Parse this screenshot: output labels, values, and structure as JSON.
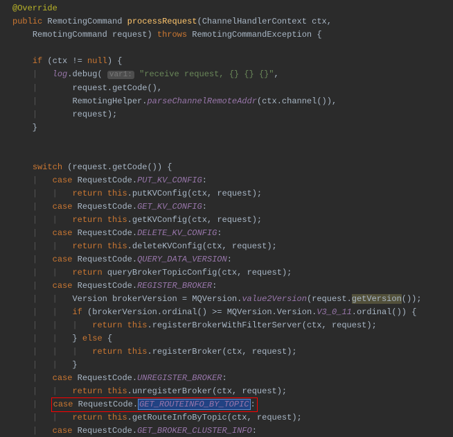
{
  "code": {
    "override": "@Override",
    "public": "public",
    "throws": "throws",
    "if": "if",
    "switch": "switch",
    "case": "case",
    "return": "return",
    "this": "this",
    "else": "else",
    "null": "null",
    "RemotingCommand": "RemotingCommand",
    "processRequest": "processRequest",
    "ChannelHandlerContext": "ChannelHandlerContext",
    "ctx": "ctx",
    "request": "request",
    "RemotingCommandException": "RemotingCommandException",
    "log": "log",
    "debug": "debug",
    "hint_var1": "var1:",
    "str_receive": "\"receive request, {} {} {}\"",
    "getCode": "getCode",
    "RemotingHelper": "RemotingHelper",
    "parseChannelRemoteAddr": "parseChannelRemoteAddr",
    "channel": "channel",
    "RequestCode": "RequestCode",
    "PUT_KV_CONFIG": "PUT_KV_CONFIG",
    "putKVConfig": "putKVConfig",
    "GET_KV_CONFIG": "GET_KV_CONFIG",
    "getKVConfig": "getKVConfig",
    "DELETE_KV_CONFIG": "DELETE_KV_CONFIG",
    "deleteKVConfig": "deleteKVConfig",
    "QUERY_DATA_VERSION": "QUERY_DATA_VERSION",
    "queryBrokerTopicConfig": "queryBrokerTopicConfig",
    "REGISTER_BROKER": "REGISTER_BROKER",
    "Version": "Version",
    "brokerVersion": "brokerVersion",
    "MQVersion": "MQVersion",
    "value2Version": "value2Version",
    "getVersion": "getVersion",
    "ordinal": "ordinal",
    "V3_0_11": "V3_0_11",
    "registerBrokerWithFilterServer": "registerBrokerWithFilterServer",
    "registerBroker": "registerBroker",
    "UNREGISTER_BROKER": "UNREGISTER_BROKER",
    "unregisterBroker": "unregisterBroker",
    "GET_ROUTEINFO_BY_TOPIC": "GET_ROUTEINFO_BY_TOPIC",
    "getRouteInfoByTopic": "getRouteInfoByTopic",
    "GET_BROKER_CLUSTER_INFO": "GET_BROKER_CLUSTER_INFO"
  }
}
